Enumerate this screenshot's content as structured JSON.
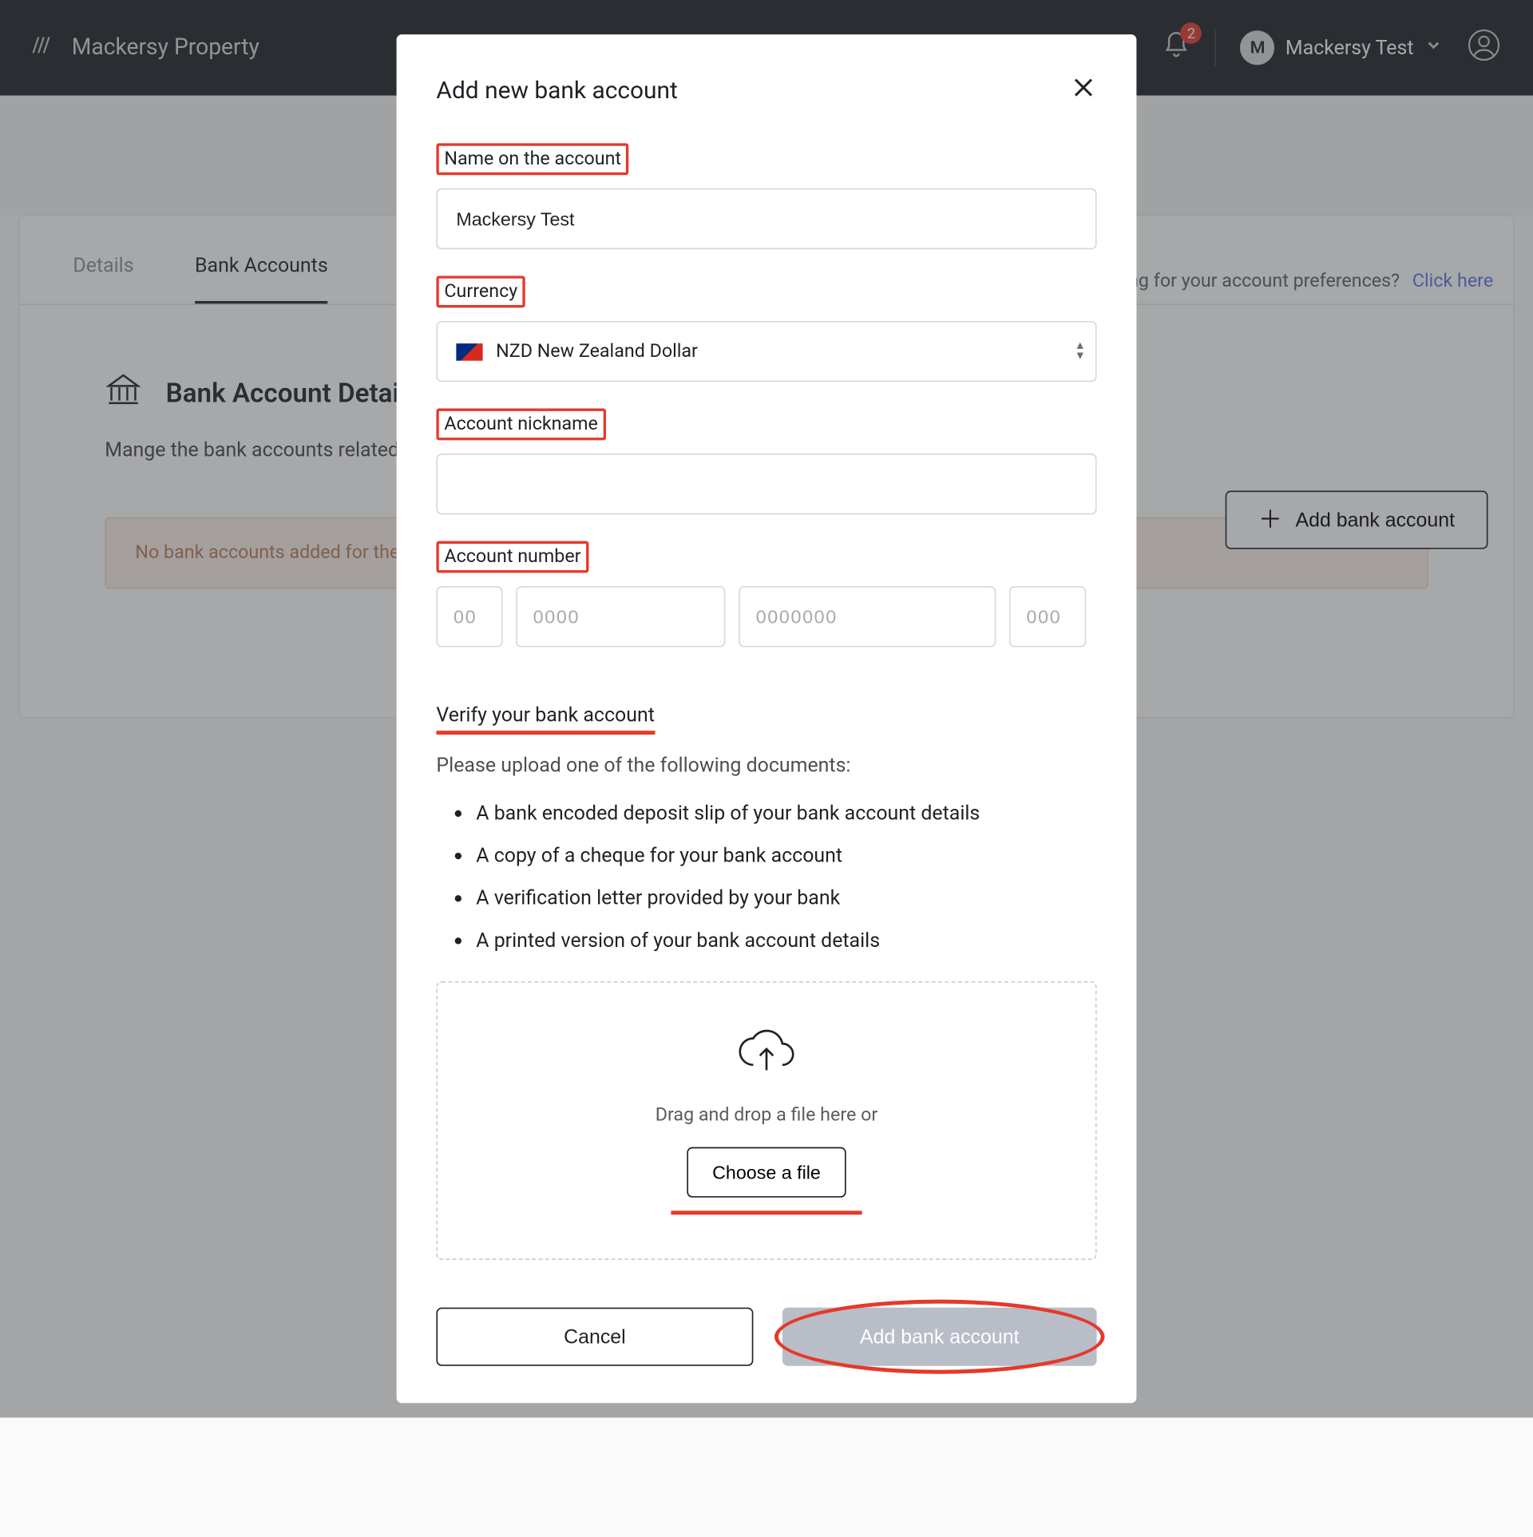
{
  "header": {
    "brand": "Mackersy Property",
    "badge_count": "2",
    "user_initial": "M",
    "user_name": "Mackersy Test"
  },
  "page": {
    "pref_text": "Looking for your account preferences?",
    "pref_link": "Click here",
    "tabs": {
      "details": "Details",
      "bank": "Bank Accounts"
    },
    "section_title": "Bank Account Details",
    "section_desc": "Mange the bank accounts related to this investing entity below.",
    "add_btn": "Add bank account",
    "empty_banner": "No bank accounts added for the entity"
  },
  "modal": {
    "title": "Add new bank account",
    "name_label": "Name on the account",
    "name_value": "Mackersy Test",
    "currency_label": "Currency",
    "currency_value": "NZD New Zealand Dollar",
    "nickname_label": "Account nickname",
    "nickname_value": "",
    "acct_label": "Account number",
    "ph1": "00",
    "ph2": "0000",
    "ph3": "0000000",
    "ph4": "000",
    "verify_title": "Verify your bank account",
    "verify_lead": "Please upload one of the following documents:",
    "verify_items": {
      "0": "A bank encoded deposit slip of your bank account details",
      "1": "A copy of a cheque for your bank account",
      "2": "A verification letter provided by your bank",
      "3": "A printed version of your bank account details"
    },
    "drop_text": "Drag and drop a file here or",
    "choose_label": "Choose a file",
    "cancel": "Cancel",
    "submit": "Add bank account"
  }
}
